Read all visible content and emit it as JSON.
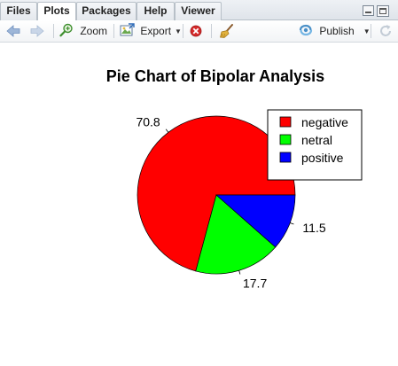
{
  "tabs": [
    {
      "label": "Files"
    },
    {
      "label": "Plots"
    },
    {
      "label": "Packages"
    },
    {
      "label": "Help"
    },
    {
      "label": "Viewer"
    }
  ],
  "active_tab": "Plots",
  "toolbar": {
    "back_icon": "arrow-left-icon",
    "forward_icon": "arrow-right-icon",
    "zoom_label": "Zoom",
    "export_label": "Export",
    "remove_icon": "remove-plot-icon",
    "clear_icon": "broom-icon",
    "publish_label": "Publish",
    "refresh_icon": "refresh-icon"
  },
  "chart_data": {
    "type": "pie",
    "title": "Pie Chart of Bipolar Analysis",
    "slices": [
      {
        "name": "negative",
        "value": 70.8,
        "color": "#ff0000"
      },
      {
        "name": "netral",
        "value": 17.7,
        "color": "#00ff00"
      },
      {
        "name": "positive",
        "value": 11.5,
        "color": "#0000ff"
      }
    ],
    "slice_labels": [
      "70.8",
      "17.7",
      "11.5"
    ],
    "start": "3 o'clock",
    "direction": "counterclockwise",
    "legend": "top-right"
  }
}
